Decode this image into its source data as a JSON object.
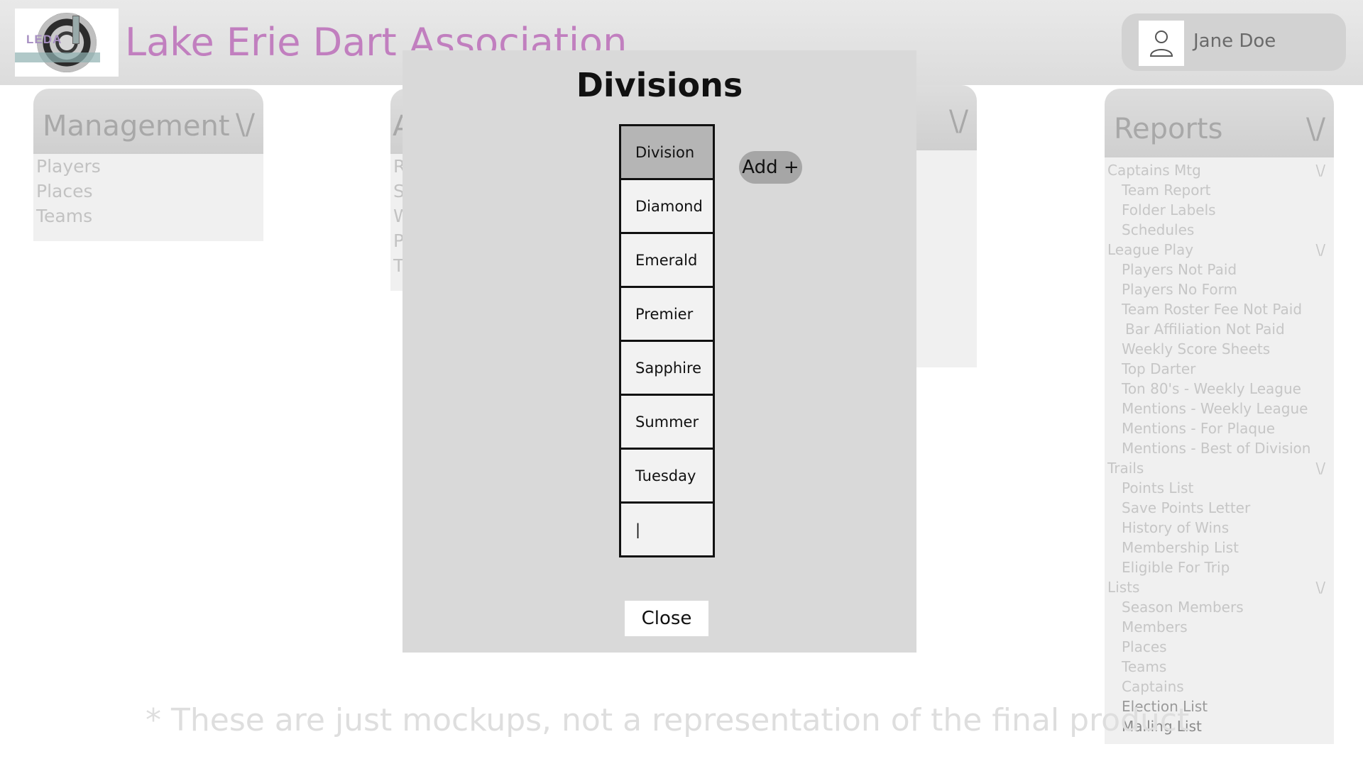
{
  "header": {
    "logo_text": "LEDA",
    "title": "Lake Erie Dart Association",
    "user_name": "Jane Doe"
  },
  "management": {
    "title": "Management",
    "chevron": "\\/",
    "items": [
      "Players",
      "Places",
      "Teams"
    ]
  },
  "panel2": {
    "title_fragment": "A",
    "items_fragment": [
      "R",
      "S",
      "W",
      "P",
      "T"
    ]
  },
  "panel3": {
    "chevron": "\\/"
  },
  "reports": {
    "title": "Reports",
    "chevron": "\\/",
    "groups": [
      {
        "label": "Captains Mtg",
        "chevron": "\\/",
        "items": [
          "Team Report",
          "Folder Labels",
          "Schedules"
        ]
      },
      {
        "label": "League Play",
        "chevron": "\\/",
        "items": [
          "Players Not Paid",
          "Players No Form",
          "Team Roster Fee Not Paid",
          "Bar Affiliation Not Paid",
          "Weekly Score Sheets",
          "Top Darter",
          "Ton 80's - Weekly League",
          "Mentions - Weekly League",
          "Mentions - For Plaque",
          "Mentions - Best of Division"
        ]
      },
      {
        "label": "Trails",
        "chevron": "\\/",
        "items": [
          "Points List",
          "Save Points Letter",
          "History of Wins",
          "Membership List",
          "Eligible For Trip"
        ]
      },
      {
        "label": "Lists",
        "chevron": "\\/",
        "items": [
          "Season Members",
          "Members",
          "Places",
          "Teams",
          "Captains",
          "Election List",
          "Mailing List"
        ]
      }
    ]
  },
  "disclaimer": "*  These are just mockups, not a representation of the final product",
  "modal": {
    "title": "Divisions",
    "column_header": "Division",
    "divisions": [
      "Diamond",
      "Emerald",
      "Premier",
      "Sapphire",
      "Summer",
      "Tuesday"
    ],
    "new_entry_value": "|",
    "add_label": "Add +",
    "close_label": "Close"
  }
}
